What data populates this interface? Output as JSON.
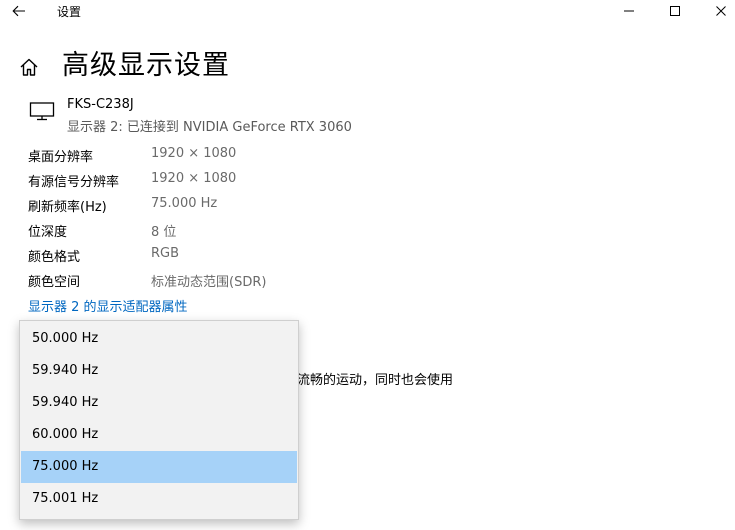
{
  "window": {
    "title": "设置"
  },
  "page": {
    "title": "高级显示设置"
  },
  "monitor": {
    "name": "FKS-C238J",
    "description": "显示器 2: 已连接到 NVIDIA GeForce RTX 3060"
  },
  "info": [
    {
      "label": "桌面分辨率",
      "value": "1920 × 1080"
    },
    {
      "label": "有源信号分辨率",
      "value": "1920 × 1080"
    },
    {
      "label": "刷新频率(Hz)",
      "value": "75.000 Hz"
    },
    {
      "label": "位深度",
      "value": "8 位"
    },
    {
      "label": "颜色格式",
      "value": "RGB"
    },
    {
      "label": "颜色空间",
      "value": "标准动态范围(SDR)"
    }
  ],
  "adapter_link": "显示器 2 的显示适配器属性",
  "background_text": "流畅的运动，同时也会使用",
  "refresh_dropdown": {
    "selected_index": 4,
    "options": [
      "50.000 Hz",
      "59.940 Hz",
      "59.940 Hz",
      "60.000 Hz",
      "75.000 Hz",
      "75.001 Hz"
    ]
  },
  "colors": {
    "link": "#0067c0",
    "selected_option": "#a6d2f8"
  }
}
